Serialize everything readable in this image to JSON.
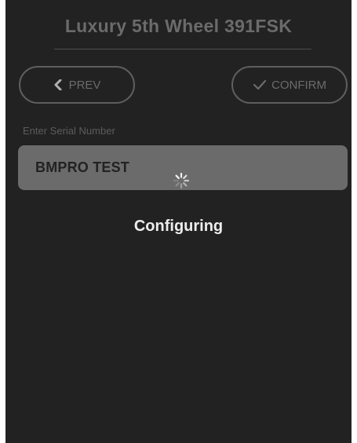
{
  "header": {
    "title": "Luxury 5th Wheel 391FSK"
  },
  "nav": {
    "prev_label": "PREV",
    "confirm_label": "CONFIRM",
    "prev_icon": "chevron-left-icon",
    "confirm_icon": "checkmark-icon"
  },
  "serial": {
    "label": "Enter Serial Number",
    "value": "BMPRO TEST"
  },
  "status": {
    "text": "Configuring",
    "icon": "spinner-icon"
  },
  "colors": {
    "background": "#222222",
    "button_border": "#5e5e5e",
    "input_background": "#6b6b6b",
    "status_text": "#ededed"
  }
}
